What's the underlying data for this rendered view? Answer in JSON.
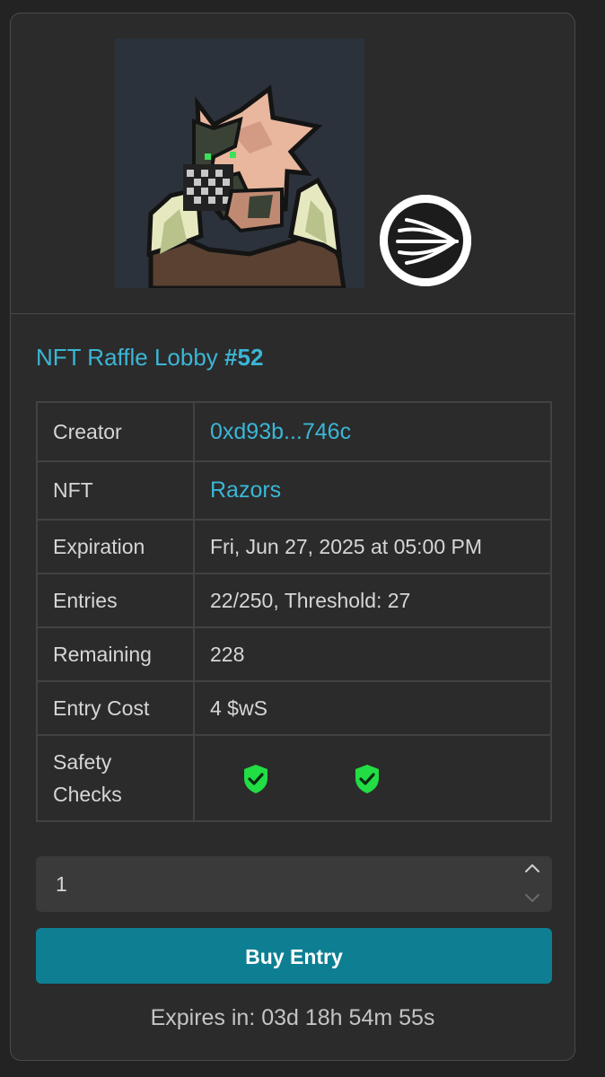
{
  "lobby": {
    "title_prefix": "NFT Raffle Lobby",
    "title_number": "#52"
  },
  "icons": {
    "nft_image": "pixel-art-character-nft",
    "chain_logo": "sonic-chain-logo",
    "safety_check": "green-shield-check-icon",
    "spin_up": "chevron-up-icon",
    "spin_down": "chevron-down-icon"
  },
  "details": {
    "creator": {
      "label": "Creator",
      "value": "0xd93b...746c"
    },
    "nft": {
      "label": "NFT",
      "value": "Razors"
    },
    "expiration": {
      "label": "Expiration",
      "value": "Fri, Jun 27, 2025 at 05:00 PM"
    },
    "entries": {
      "label": "Entries",
      "value": "22/250, Threshold: 27"
    },
    "remaining": {
      "label": "Remaining",
      "value": "228"
    },
    "entry_cost": {
      "label": "Entry Cost",
      "value": "4 $wS"
    },
    "safety": {
      "label_line1": "Safety",
      "label_line2": "Checks"
    }
  },
  "quantity": {
    "value": "1"
  },
  "buy_button": {
    "label": "Buy Entry"
  },
  "expires": {
    "text": "Expires in: 03d 18h 54m 55s"
  },
  "colors": {
    "accent": "#3bb6d6",
    "button": "#0e7f93",
    "check": "#22dd44",
    "card_bg": "#2b2b2b"
  }
}
